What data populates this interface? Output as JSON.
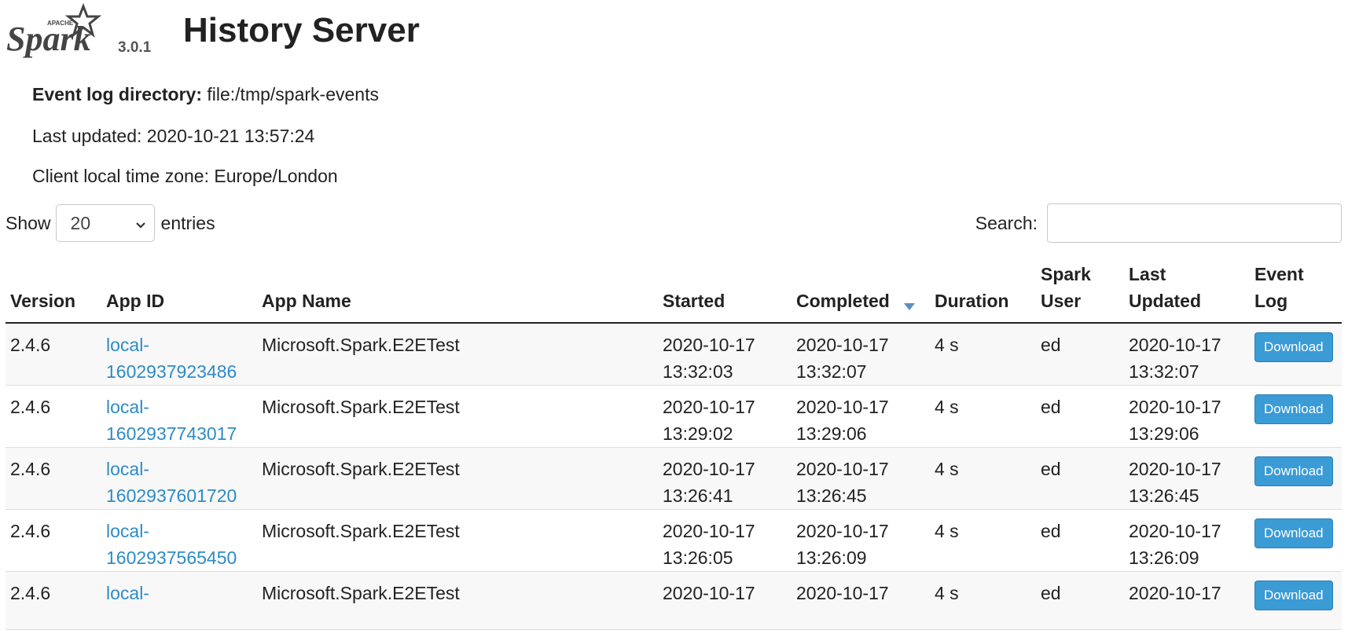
{
  "header": {
    "logo_text": "Spark",
    "logo_super": "APACHE",
    "version": "3.0.1",
    "title": "History Server"
  },
  "info": {
    "event_log_label": "Event log directory:",
    "event_log_value": "file:/tmp/spark-events",
    "last_updated": "Last updated: 2020-10-21 13:57:24",
    "timezone": "Client local time zone: Europe/London"
  },
  "controls": {
    "show_label": "Show",
    "entries_value": "20",
    "entries_label": "entries",
    "search_label": "Search:",
    "search_value": ""
  },
  "table": {
    "columns": {
      "version": "Version",
      "app_id": "App ID",
      "app_name": "App Name",
      "started": "Started",
      "completed": "Completed",
      "duration": "Duration",
      "spark_user_1": "Spark",
      "spark_user_2": "User",
      "last_updated_1": "Last",
      "last_updated_2": "Updated",
      "event_log_1": "Event",
      "event_log_2": "Log"
    },
    "rows": [
      {
        "version": "2.4.6",
        "app_id_1": "local-",
        "app_id_2": "1602937923486",
        "app_name": "Microsoft.Spark.E2ETest",
        "started_1": "2020-10-17",
        "started_2": "13:32:03",
        "completed_1": "2020-10-17",
        "completed_2": "13:32:07",
        "duration": "4 s",
        "user": "ed",
        "updated_1": "2020-10-17",
        "updated_2": "13:32:07",
        "download": "Download"
      },
      {
        "version": "2.4.6",
        "app_id_1": "local-",
        "app_id_2": "1602937743017",
        "app_name": "Microsoft.Spark.E2ETest",
        "started_1": "2020-10-17",
        "started_2": "13:29:02",
        "completed_1": "2020-10-17",
        "completed_2": "13:29:06",
        "duration": "4 s",
        "user": "ed",
        "updated_1": "2020-10-17",
        "updated_2": "13:29:06",
        "download": "Download"
      },
      {
        "version": "2.4.6",
        "app_id_1": "local-",
        "app_id_2": "1602937601720",
        "app_name": "Microsoft.Spark.E2ETest",
        "started_1": "2020-10-17",
        "started_2": "13:26:41",
        "completed_1": "2020-10-17",
        "completed_2": "13:26:45",
        "duration": "4 s",
        "user": "ed",
        "updated_1": "2020-10-17",
        "updated_2": "13:26:45",
        "download": "Download"
      },
      {
        "version": "2.4.6",
        "app_id_1": "local-",
        "app_id_2": "1602937565450",
        "app_name": "Microsoft.Spark.E2ETest",
        "started_1": "2020-10-17",
        "started_2": "13:26:05",
        "completed_1": "2020-10-17",
        "completed_2": "13:26:09",
        "duration": "4 s",
        "user": "ed",
        "updated_1": "2020-10-17",
        "updated_2": "13:26:09",
        "download": "Download"
      },
      {
        "version": "2.4.6",
        "app_id_1": "local-",
        "app_id_2": "",
        "app_name": "Microsoft.Spark.E2ETest",
        "started_1": "2020-10-17",
        "started_2": "",
        "completed_1": "2020-10-17",
        "completed_2": "",
        "duration": "4 s",
        "user": "ed",
        "updated_1": "2020-10-17",
        "updated_2": "",
        "download": "Download"
      }
    ]
  },
  "colors": {
    "link": "#2d8bc8",
    "button": "#3a9bd5",
    "sort_arrow": "#5b8fc0"
  }
}
